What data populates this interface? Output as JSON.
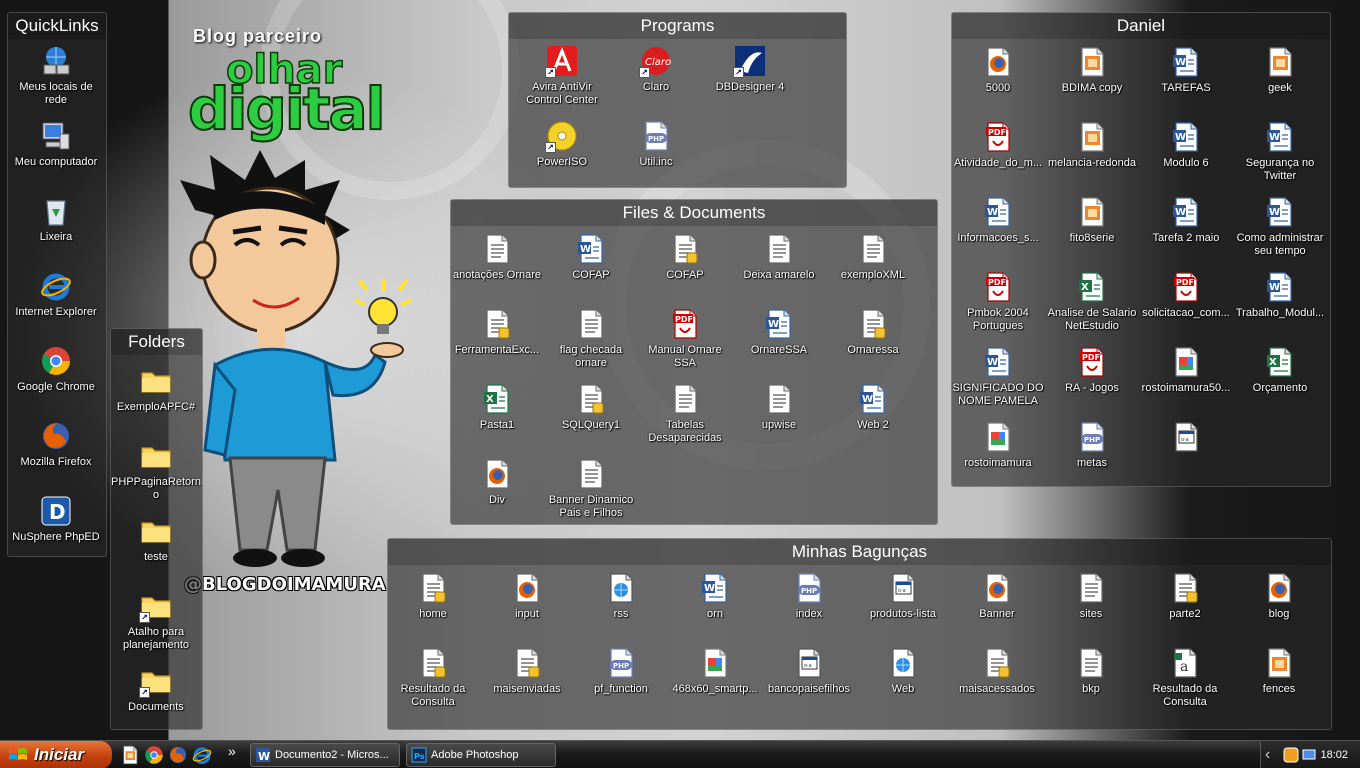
{
  "fences": {
    "quicklinks": {
      "title": "QuickLinks",
      "items": [
        {
          "label": "Meus locais de rede",
          "icon": "network-places-icon"
        },
        {
          "label": "Meu computador",
          "icon": "my-computer-icon"
        },
        {
          "label": "Lixeira",
          "icon": "recycle-bin-icon"
        },
        {
          "label": "Internet Explorer",
          "icon": "internet-explorer-icon"
        },
        {
          "label": "Google Chrome",
          "icon": "chrome-icon"
        },
        {
          "label": "Mozilla Firefox",
          "icon": "firefox-icon"
        },
        {
          "label": "NuSphere PhpED",
          "icon": "phped-icon"
        }
      ]
    },
    "folders": {
      "title": "Folders",
      "items": [
        {
          "label": "ExemploAPFC#",
          "icon": "folder-icon"
        },
        {
          "label": "PHPPaginaRetorno",
          "icon": "folder-icon"
        },
        {
          "label": "teste",
          "icon": "folder-icon"
        },
        {
          "label": "Atalho para planejamento",
          "icon": "folder-shortcut-icon"
        },
        {
          "label": "Documents",
          "icon": "folder-shortcut-icon"
        }
      ]
    },
    "programs": {
      "title": "Programs",
      "items": [
        {
          "label": "Avira AntiVir Control Center",
          "icon": "avira-icon"
        },
        {
          "label": "Claro",
          "icon": "claro-icon"
        },
        {
          "label": "DBDesigner 4",
          "icon": "dbdesigner-icon"
        },
        {
          "label": "PowerISO",
          "icon": "poweriso-icon"
        },
        {
          "label": "Util.inc",
          "icon": "php-file-icon"
        }
      ]
    },
    "files": {
      "title": "Files & Documents",
      "items": [
        {
          "label": "anotações Ornare",
          "icon": "text-file-icon"
        },
        {
          "label": "COFAP",
          "icon": "word-doc-icon"
        },
        {
          "label": "COFAP",
          "icon": "sql-file-icon"
        },
        {
          "label": "Deixa amarelo",
          "icon": "text-file-icon"
        },
        {
          "label": "exemploXML",
          "icon": "text-file-icon"
        },
        {
          "label": "FerramentaExc...",
          "icon": "sql-file-icon"
        },
        {
          "label": "flag checada ornare",
          "icon": "text-file-icon"
        },
        {
          "label": "Manual Ornare SSA",
          "icon": "pdf-file-icon"
        },
        {
          "label": "OrnareSSA",
          "icon": "word-doc-icon"
        },
        {
          "label": "Ornaressa",
          "icon": "sql-file-icon"
        },
        {
          "label": "Pasta1",
          "icon": "excel-file-icon"
        },
        {
          "label": "SQLQuery1",
          "icon": "sql-file-icon"
        },
        {
          "label": "Tabelas Desaparecidas",
          "icon": "text-file-icon"
        },
        {
          "label": "upwise",
          "icon": "text-file-icon"
        },
        {
          "label": "Web 2",
          "icon": "word-doc-icon"
        },
        {
          "label": "Div",
          "icon": "firefox-html-icon"
        },
        {
          "label": "Banner Dinamico Pais e Filhos",
          "icon": "text-file-icon"
        }
      ]
    },
    "daniel": {
      "title": "Daniel",
      "items": [
        {
          "label": "5000",
          "icon": "firefox-html-icon"
        },
        {
          "label": "BDIMA copy",
          "icon": "image-file-icon"
        },
        {
          "label": "TAREFAS",
          "icon": "word-doc-icon"
        },
        {
          "label": "geek",
          "icon": "image-file-icon"
        },
        {
          "label": "Atividade_do_m...",
          "icon": "pdf-file-icon"
        },
        {
          "label": "melancia-redonda",
          "icon": "image-file-icon"
        },
        {
          "label": "Modulo 6",
          "icon": "word-doc-icon"
        },
        {
          "label": "Segurança no Twitter",
          "icon": "word-doc-icon"
        },
        {
          "label": "Informacoes_s...",
          "icon": "word-doc-icon"
        },
        {
          "label": "fito8serie",
          "icon": "image-file-icon"
        },
        {
          "label": "Tarefa 2 maio",
          "icon": "word-doc-icon"
        },
        {
          "label": "Como administrar seu tempo",
          "icon": "word-doc-icon"
        },
        {
          "label": "Pmbok 2004 Portugues",
          "icon": "pdf-file-icon"
        },
        {
          "label": "Analise de Salario NetEstudio",
          "icon": "excel-file-icon"
        },
        {
          "label": "solicitacao_com...",
          "icon": "pdf-file-icon"
        },
        {
          "label": "Trabalho_Modul...",
          "icon": "word-doc-icon"
        },
        {
          "label": "SIGNIFICADO DO NOME PAMELA",
          "icon": "word-doc-icon"
        },
        {
          "label": "RA - Jogos",
          "icon": "pdf-file-icon"
        },
        {
          "label": "rostoimamura50...",
          "icon": "picture-file-icon"
        },
        {
          "label": "Orçamento",
          "icon": "excel-file-icon"
        },
        {
          "label": "rostoimamura",
          "icon": "picture-file-icon"
        },
        {
          "label": "metas",
          "icon": "php-file-icon"
        },
        {
          "label": "",
          "icon": "window-file-icon"
        }
      ]
    },
    "bagunca": {
      "title": "Minhas Bagunças",
      "items": [
        {
          "label": "home",
          "icon": "sql-file-icon"
        },
        {
          "label": "input",
          "icon": "firefox-html-icon"
        },
        {
          "label": "rss",
          "icon": "web-file-icon"
        },
        {
          "label": "orn",
          "icon": "word-doc-icon"
        },
        {
          "label": "index",
          "icon": "php-file-icon"
        },
        {
          "label": "produtos-lista",
          "icon": "window-file-icon"
        },
        {
          "label": "Banner",
          "icon": "firefox-html-icon"
        },
        {
          "label": "sites",
          "icon": "text-file-icon"
        },
        {
          "label": "parte2",
          "icon": "sql-file-icon"
        },
        {
          "label": "blog",
          "icon": "firefox-html-icon"
        },
        {
          "label": "Resultado da Consulta",
          "icon": "sql-file-icon"
        },
        {
          "label": "maisenviadas",
          "icon": "sql-file-icon"
        },
        {
          "label": "pf_function",
          "icon": "php-file-icon"
        },
        {
          "label": "468x60_smartp...",
          "icon": "picture-file-icon"
        },
        {
          "label": "bancopaisefilhos",
          "icon": "window-file-icon"
        },
        {
          "label": "Web",
          "icon": "web-file-icon"
        },
        {
          "label": "maisacessados",
          "icon": "sql-file-icon"
        },
        {
          "label": "bkp",
          "icon": "text-file-icon"
        },
        {
          "label": "Resultado da Consulta",
          "icon": "font-file-icon"
        },
        {
          "label": "fences",
          "icon": "image-file-icon"
        }
      ]
    }
  },
  "wallpaper": {
    "top_text": "Blog parceiro",
    "logo_olhar": "olhar",
    "logo_digital": "digital",
    "handle": "@BLOGDOIMAMURA"
  },
  "taskbar": {
    "start_label": "Iniciar",
    "quick_launch": [
      "fences-icon",
      "chrome-icon",
      "firefox-icon",
      "internet-explorer-icon"
    ],
    "overflow": "»",
    "tasks": [
      {
        "label": "Documento2 - Micros...",
        "icon": "word-icon"
      },
      {
        "label": "Adobe Photoshop",
        "icon": "photoshop-icon"
      }
    ],
    "tray_arrow": "‹",
    "clock": "18:02"
  },
  "colors": {
    "logo_green": "#2ecc40",
    "start_orange": "#c4420e",
    "fence_bg": "rgba(40,40,40,0.62)"
  }
}
